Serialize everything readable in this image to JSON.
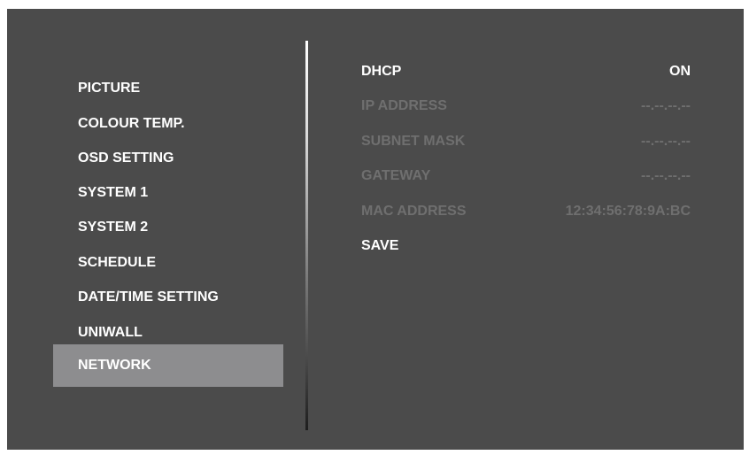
{
  "colors": {
    "screen_background": "#4b4b4b",
    "selected_highlight": "#8d8d8f",
    "text_enabled": "#ffffff",
    "text_disabled": "#6f6f6f"
  },
  "menu": {
    "items": [
      {
        "label": "PICTURE"
      },
      {
        "label": "COLOUR TEMP."
      },
      {
        "label": "OSD SETTING"
      },
      {
        "label": "SYSTEM 1"
      },
      {
        "label": "SYSTEM 2"
      },
      {
        "label": "SCHEDULE"
      },
      {
        "label": "DATE/TIME SETTING"
      },
      {
        "label": "UNIWALL"
      },
      {
        "label": "NETWORK"
      }
    ],
    "selected": "NETWORK"
  },
  "network": {
    "dhcp": {
      "label": "DHCP",
      "value": "ON"
    },
    "ip_address": {
      "label": "IP ADDRESS",
      "value": "--.--.--.--"
    },
    "subnet_mask": {
      "label": "SUBNET MASK",
      "value": "--.--.--.--"
    },
    "gateway": {
      "label": "GATEWAY",
      "value": "--.--.--.--"
    },
    "mac_address": {
      "label": "MAC ADDRESS",
      "value": "12:34:56:78:9A:BC"
    },
    "save": {
      "label": "SAVE"
    }
  }
}
